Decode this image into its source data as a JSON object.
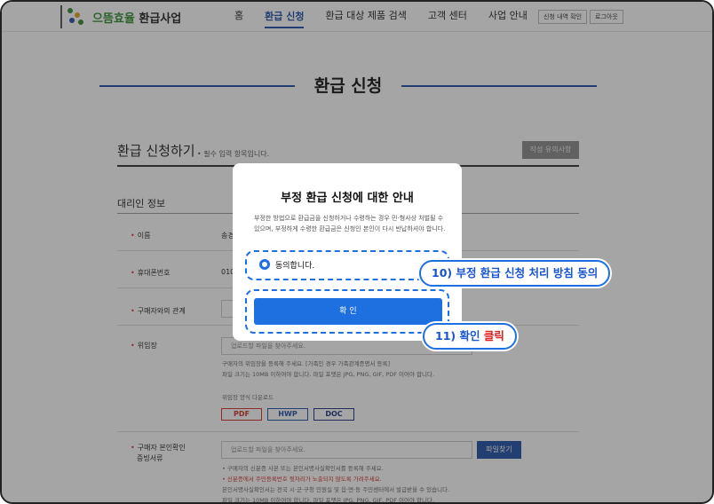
{
  "header": {
    "logo_name": "으뜸효율",
    "logo_suffix": "환급사업",
    "nav": [
      "홈",
      "환급 신청",
      "환급 대상 제품 검색",
      "고객 센터",
      "사업 안내"
    ],
    "history_button": "신청 내역 확인",
    "logout_button": "로그아웃"
  },
  "page": {
    "title": "환급 신청",
    "section_title": "환급 신청하기",
    "section_note": "• 필수 입력 항목입니다.",
    "caution_button": "작성 유의사항",
    "subsection_title": "대리인 정보",
    "fields": {
      "name_label": "이름",
      "name_value": "송경",
      "phone_label": "휴대폰번호",
      "phone_value": "010",
      "relation_label": "구매자와의 관계",
      "poa_label": "위임장",
      "poa_placeholder": "업로드할 파일을 찾아주세요.",
      "poa_help_1": "구매자의 위임장을 등록해 주세요. [가족인 경우 가족관계증명서 등록]",
      "poa_help_2": "파일 크기는 10MB 이하여야 합니다. 파일 포맷은 JPG, PNG, GIF, PDF 이어야 합니다.",
      "poa_download_label": "위임장 양식 다운로드",
      "file_formats": [
        "PDF",
        "HWP",
        "DOC"
      ],
      "id_label_1": "구매자 본인확인",
      "id_label_2": "증빙서류",
      "id_placeholder": "업로드할 파일을 찾아주세요.",
      "find_button": "파일찾기",
      "id_help_1": "• 구매자의 신분증 사본 또는 본인서명사실확인서를 등록해 주세요.",
      "id_help_2": "• 신분증에서 주민등록번호 뒷자리가 노출되지 않도록 가려주세요.",
      "id_help_3": "본인서명사실확인서는 전국 시·군·구청 민원실 및 읍·면·동 주민센터에서 발급받을 수 있습니다.",
      "id_help_4": "파일 크기는 10MB 이하여야 합니다. 파일 포맷은 JPG, PNG, GIF, PDF 이어야 합니다."
    }
  },
  "modal": {
    "title": "부정 환급 신청에 대한 안내",
    "description": "부정한 방법으로 환급금을 신청하거나 수령하는 경우 민·형사상 처벌될 수 있으며, 부정하게 수령한 환급금은 신청인 본인이 다시 반납하셔야 합니다.",
    "agree_label": "동의합니다.",
    "agree_checked": true,
    "confirm_button": "확 인"
  },
  "callouts": {
    "step10": "10) 부정 환급 신청 처리 방침 동의",
    "step11_prefix": "11) 확인",
    "step11_action": "클릭"
  },
  "colors": {
    "accent": "#1e6fe0",
    "brand_blue": "#1f4fa6",
    "highlight_red": "#e02020"
  }
}
